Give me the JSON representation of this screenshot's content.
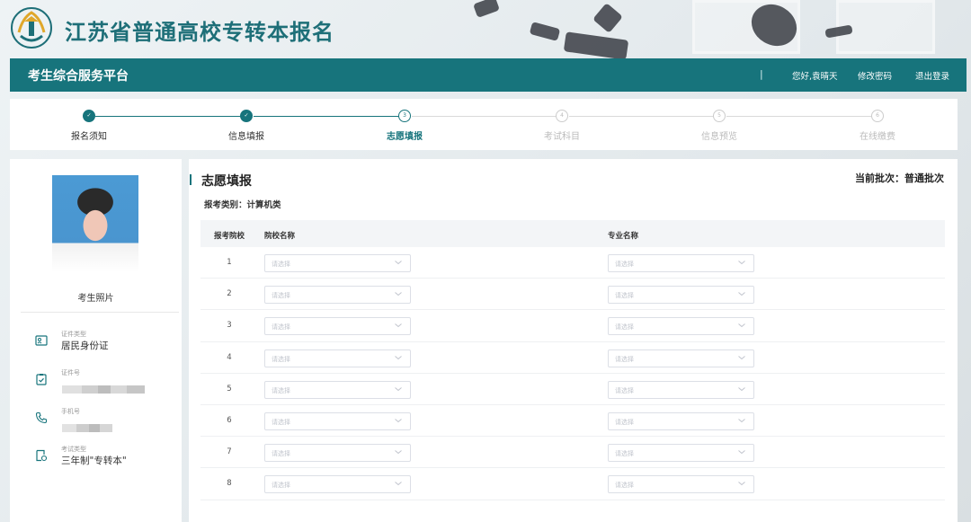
{
  "header": {
    "site_title": "江苏省普通高校专转本报名"
  },
  "navbar": {
    "brand": "考生综合服务平台",
    "separator": "|",
    "greeting": "您好,袁晴天",
    "change_password": "修改密码",
    "logout": "退出登录"
  },
  "steps": [
    {
      "label": "报名须知",
      "status": "done",
      "marker": "✓"
    },
    {
      "label": "信息填报",
      "status": "done",
      "marker": "✓"
    },
    {
      "label": "志愿填报",
      "status": "active",
      "marker": "3"
    },
    {
      "label": "考试科目",
      "status": "todo",
      "marker": "4"
    },
    {
      "label": "信息预览",
      "status": "todo",
      "marker": "5"
    },
    {
      "label": "在线缴费",
      "status": "todo",
      "marker": "6"
    }
  ],
  "profile": {
    "photo_caption": "考生照片",
    "id_type_label": "证件类型",
    "id_type_value": "居民身份证",
    "id_number_label": "证件号",
    "phone_label": "手机号",
    "exam_type_label": "考试类型",
    "exam_type_value": "三年制\"专转本\""
  },
  "main": {
    "title": "志愿填报",
    "batch": "当前批次：普通批次",
    "category": "报考类别：计算机类",
    "columns": {
      "school_no": "报考院校",
      "school_name": "院校名称",
      "major_name": "专业名称"
    },
    "rows": [
      {
        "no": "1",
        "school_placeholder": "请选择",
        "major_placeholder": "请选择"
      },
      {
        "no": "2",
        "school_placeholder": "请选择",
        "major_placeholder": "请选择"
      },
      {
        "no": "3",
        "school_placeholder": "请选择",
        "major_placeholder": "请选择"
      },
      {
        "no": "4",
        "school_placeholder": "请选择",
        "major_placeholder": "请选择"
      },
      {
        "no": "5",
        "school_placeholder": "请选择",
        "major_placeholder": "请选择"
      },
      {
        "no": "6",
        "school_placeholder": "请选择",
        "major_placeholder": "请选择"
      },
      {
        "no": "7",
        "school_placeholder": "请选择",
        "major_placeholder": "请选择"
      },
      {
        "no": "8",
        "school_placeholder": "请选择",
        "major_placeholder": "请选择"
      }
    ]
  },
  "colors": {
    "primary_teal": "#17747c",
    "title_teal": "#1e6f78",
    "step_todo": "#bbbbbb",
    "select_border": "#dcdfe6"
  }
}
